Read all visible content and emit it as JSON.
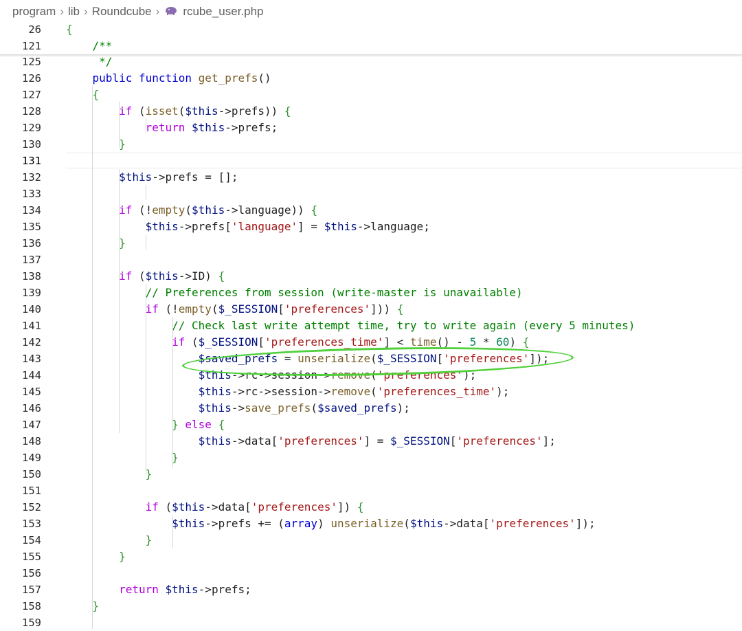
{
  "breadcrumb": {
    "items": [
      "program",
      "lib",
      "Roundcube"
    ],
    "file_icon": "php-elephant-icon",
    "file": "rcube_user.php"
  },
  "colors": {
    "keyword": "#0000d0",
    "control": "#af00db",
    "variable": "#001080",
    "function": "#795e26",
    "string": "#a31515",
    "number": "#098658",
    "comment": "#008000",
    "annotation": "#4fd03a"
  },
  "editor": {
    "active_line": 131,
    "highlighted_line": 143,
    "sticky_lines": [
      {
        "num": 26,
        "text": "{"
      },
      {
        "num": 121,
        "text": "    /**"
      }
    ],
    "lines": [
      {
        "num": 125,
        "text": "     */"
      },
      {
        "num": 126,
        "text": "    public function get_prefs()"
      },
      {
        "num": 127,
        "text": "    {"
      },
      {
        "num": 128,
        "text": "        if (isset($this->prefs)) {"
      },
      {
        "num": 129,
        "text": "            return $this->prefs;"
      },
      {
        "num": 130,
        "text": "        }"
      },
      {
        "num": 131,
        "text": ""
      },
      {
        "num": 132,
        "text": "        $this->prefs = [];"
      },
      {
        "num": 133,
        "text": ""
      },
      {
        "num": 134,
        "text": "        if (!empty($this->language)) {"
      },
      {
        "num": 135,
        "text": "            $this->prefs['language'] = $this->language;"
      },
      {
        "num": 136,
        "text": "        }"
      },
      {
        "num": 137,
        "text": ""
      },
      {
        "num": 138,
        "text": "        if ($this->ID) {"
      },
      {
        "num": 139,
        "text": "            // Preferences from session (write-master is unavailable)"
      },
      {
        "num": 140,
        "text": "            if (!empty($_SESSION['preferences'])) {"
      },
      {
        "num": 141,
        "text": "                // Check last write attempt time, try to write again (every 5 minutes)"
      },
      {
        "num": 142,
        "text": "                if ($_SESSION['preferences_time'] < time() - 5 * 60) {"
      },
      {
        "num": 143,
        "text": "                    $saved_prefs = unserialize($_SESSION['preferences']);"
      },
      {
        "num": 144,
        "text": "                    $this->rc->session->remove('preferences');"
      },
      {
        "num": 145,
        "text": "                    $this->rc->session->remove('preferences_time');"
      },
      {
        "num": 146,
        "text": "                    $this->save_prefs($saved_prefs);"
      },
      {
        "num": 147,
        "text": "                } else {"
      },
      {
        "num": 148,
        "text": "                    $this->data['preferences'] = $_SESSION['preferences'];"
      },
      {
        "num": 149,
        "text": "                }"
      },
      {
        "num": 150,
        "text": "            }"
      },
      {
        "num": 151,
        "text": ""
      },
      {
        "num": 152,
        "text": "            if ($this->data['preferences']) {"
      },
      {
        "num": 153,
        "text": "                $this->prefs += (array) unserialize($this->data['preferences']);"
      },
      {
        "num": 154,
        "text": "            }"
      },
      {
        "num": 155,
        "text": "        }"
      },
      {
        "num": 156,
        "text": ""
      },
      {
        "num": 157,
        "text": "        return $this->prefs;"
      },
      {
        "num": 158,
        "text": "    }"
      },
      {
        "num": 159,
        "text": ""
      }
    ]
  }
}
